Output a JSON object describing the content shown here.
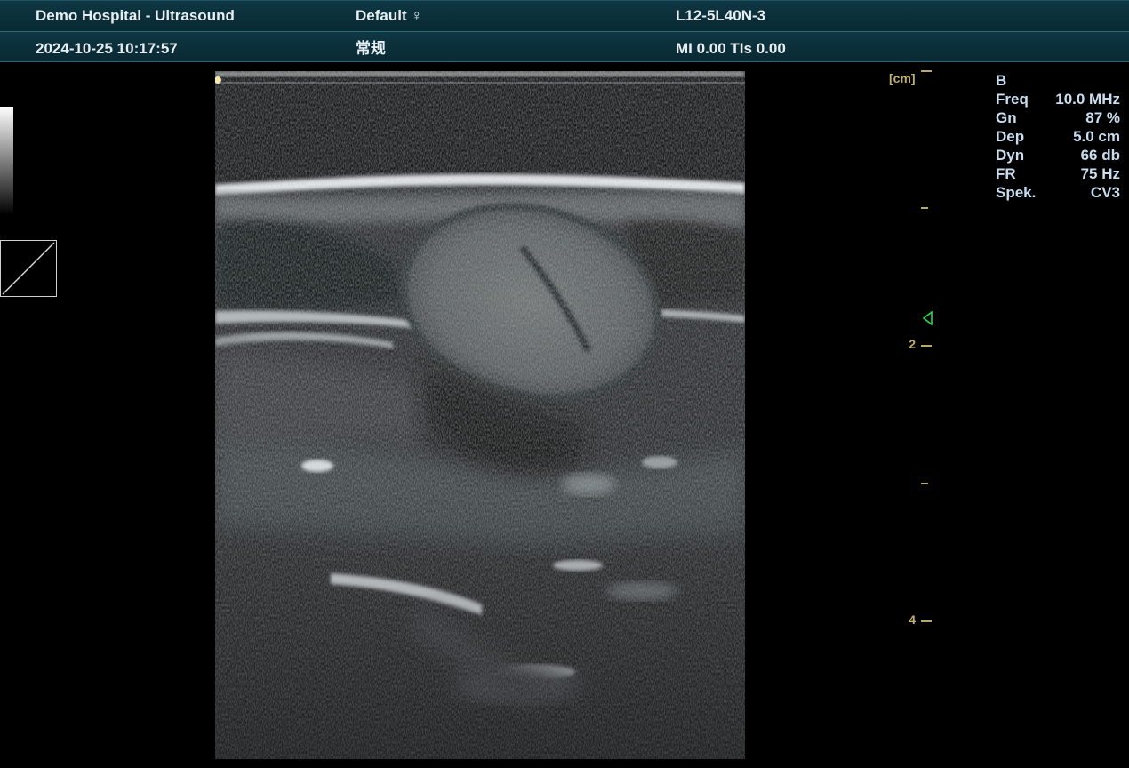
{
  "header": {
    "hospital": "Demo Hospital - Ultrasound",
    "preset": "Default ♀",
    "probe": "L12-5L40N-3",
    "datetime": "2024-10-25 10:17:57",
    "exam_type": "常规",
    "indices": "MI 0.00 TIs 0.00"
  },
  "depth_scale": {
    "unit": "[cm]",
    "labels": [
      "2",
      "4"
    ]
  },
  "params": {
    "mode": "B",
    "rows": [
      {
        "name": "Freq",
        "value": "10.0 MHz"
      },
      {
        "name": "Gn",
        "value": "87 %"
      },
      {
        "name": "Dep",
        "value": "5.0 cm"
      },
      {
        "name": "Dyn",
        "value": "66 db"
      },
      {
        "name": "FR",
        "value": "75 Hz"
      },
      {
        "name": "Spek.",
        "value": "CV3"
      }
    ]
  },
  "icons": {
    "focus": "focus-marker-icon",
    "grayscale": "grayscale-bar",
    "gamma": "gamma-curve-icon"
  },
  "colors": {
    "header_bg": "#0b2e39",
    "scale": "#c2b06e",
    "params": "#c9def0",
    "focus_marker": "#29d94a"
  }
}
